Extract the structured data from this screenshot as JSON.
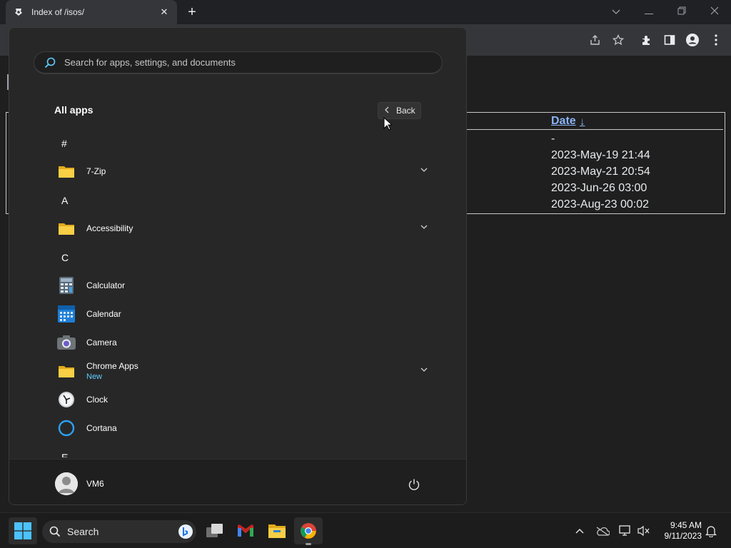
{
  "browser": {
    "tab_title": "Index of /isos/",
    "tab_close": "✕",
    "new_tab": "+"
  },
  "page": {
    "date_header": "Date",
    "sort_indicator": "↓",
    "dates": [
      "-",
      "2023-May-19 21:44",
      "2023-May-21 20:54",
      "2023-Jun-26 03:00",
      "2023-Aug-23 00:02"
    ]
  },
  "start_menu": {
    "search_placeholder": "Search for apps, settings, and documents",
    "all_apps_label": "All apps",
    "back_label": "Back",
    "groups": [
      {
        "letter": "#"
      },
      {
        "app": "7-Zip",
        "icon": "folder-icon",
        "expandable": true
      },
      {
        "letter": "A"
      },
      {
        "app": "Accessibility",
        "icon": "folder-icon",
        "expandable": true
      },
      {
        "letter": "C"
      },
      {
        "app": "Calculator",
        "icon": "calculator-icon"
      },
      {
        "app": "Calendar",
        "icon": "calendar-icon"
      },
      {
        "app": "Camera",
        "icon": "camera-icon"
      },
      {
        "app": "Chrome Apps",
        "sub": "New",
        "icon": "folder-icon",
        "expandable": true
      },
      {
        "app": "Clock",
        "icon": "clock-icon"
      },
      {
        "app": "Cortana",
        "icon": "cortana-icon"
      },
      {
        "letter": "E"
      }
    ],
    "labels": {
      "hash": "#",
      "zip": "7-Zip",
      "a": "A",
      "accessibility": "Accessibility",
      "c": "C",
      "calculator": "Calculator",
      "calendar": "Calendar",
      "camera": "Camera",
      "chrome_apps": "Chrome Apps",
      "chrome_apps_sub": "New",
      "clock": "Clock",
      "cortana": "Cortana",
      "e": "E"
    },
    "user_name": "VM6"
  },
  "taskbar": {
    "search_label": "Search",
    "time": "9:45 AM",
    "date": "9/11/2023"
  },
  "colors": {
    "accent": "#60cdff",
    "link": "#8ab4f8",
    "folder": "#f4c430"
  }
}
